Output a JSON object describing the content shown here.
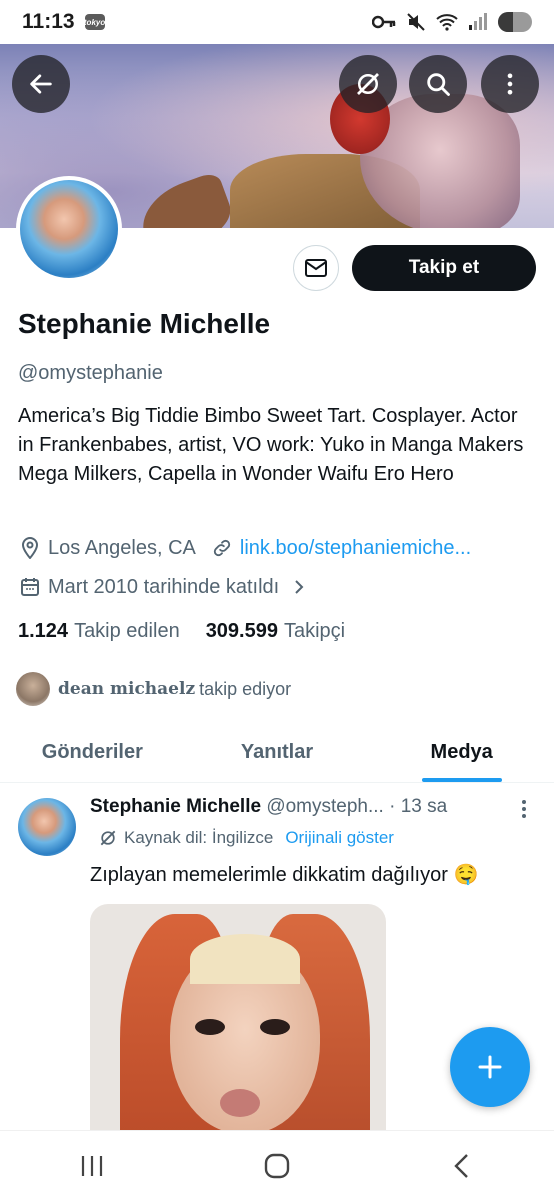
{
  "status_bar": {
    "time": "11:13",
    "app_icon_label": "tokyo",
    "battery_level": 0.45
  },
  "profile": {
    "name": "Stephanie Michelle",
    "handle": "@omystephanie",
    "bio": "America’s Big Tiddie Bimbo Sweet Tart. Cosplayer. Actor in Frankenbabes, artist, VO work: Yuko in Manga Makers Mega Milkers, Capella in Wonder Waifu Ero Hero",
    "location": "Los Angeles, CA",
    "link": "link.boo/stephaniemiche...",
    "joined": "Mart 2010 tarihinde katıldı",
    "following_count": "1.124",
    "following_label": "Takip edilen",
    "followers_count": "309.599",
    "followers_label": "Takipçi",
    "followed_by_name": "dean michaelz",
    "followed_by_suffix": "takip ediyor",
    "follow_button": "Takip et"
  },
  "tabs": [
    "Gönderiler",
    "Yanıtlar",
    "Medya"
  ],
  "active_tab": "Medya",
  "post": {
    "author_name": "Stephanie Michelle",
    "author_handle": "@omysteph...",
    "time": "· 13 sa",
    "translate_source": "Kaynak dil: İngilizce",
    "translate_action": "Orijinali göster",
    "text": "Zıplayan memelerimle dikkatim dağılıyor 🤤"
  },
  "colors": {
    "accent": "#1d9bf0",
    "text": "#0f1419",
    "muted": "#536471",
    "button_dark": "#0f1419"
  },
  "icons": [
    "back-arrow-icon",
    "translate-off-icon",
    "search-icon",
    "more-icon",
    "mail-icon",
    "location-icon",
    "link-icon",
    "calendar-icon",
    "chevron-right-icon",
    "plus-icon"
  ]
}
